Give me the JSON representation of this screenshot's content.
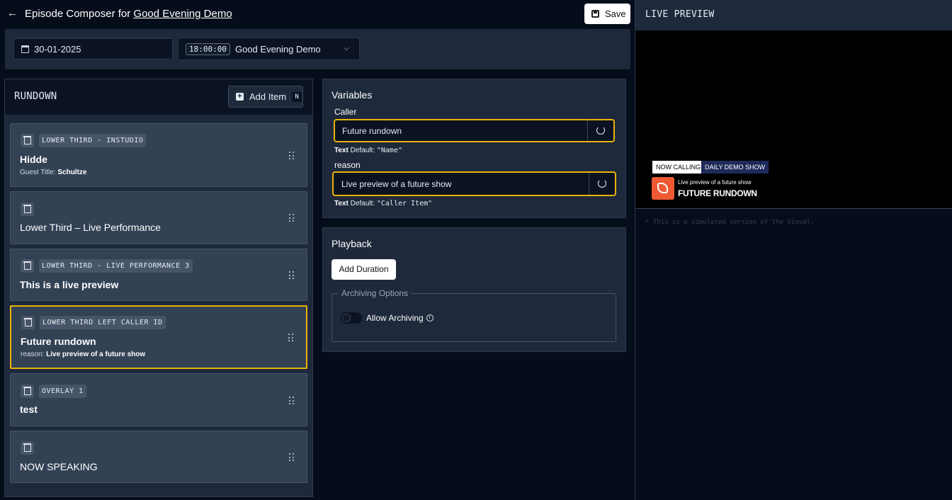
{
  "header": {
    "title_prefix": "Episode Composer for",
    "show_link": "Good Evening Demo",
    "save_label": "Save"
  },
  "datebar": {
    "date": "30-01-2025",
    "time": "18:00:00",
    "show_name": "Good Evening Demo"
  },
  "rundown": {
    "title": "RUNDOWN",
    "add_item_label": "Add Item",
    "add_item_shortcut": "N",
    "items": [
      {
        "tag": "LOWER THIRD - INSTUDIO",
        "title": "Hidde",
        "sub_label": "Guest Title:",
        "sub_value": "Schultze"
      },
      {
        "title": "Lower Third – Live Performance"
      },
      {
        "tag": "LOWER THIRD - LIVE PERFORMANCE 3",
        "title": "This is a live preview"
      },
      {
        "tag": "LOWER THIRD LEFT CALLER ID",
        "title": "Future rundown",
        "sub_label": "reason:",
        "sub_value": "Live preview of a future show"
      },
      {
        "tag": "OVERLAY 1",
        "title": "test"
      },
      {
        "title": "NOW SPEAKING"
      }
    ]
  },
  "variables": {
    "title": "Variables",
    "fields": [
      {
        "label": "Caller",
        "value": "Future rundown",
        "type": "Text",
        "default_label": "Default:",
        "default_value": "\"Name\""
      },
      {
        "label": "reason",
        "value": "Live preview of a future show",
        "type": "Text",
        "default_label": "Default:",
        "default_value": "\"Caller Item\""
      }
    ]
  },
  "playback": {
    "title": "Playback",
    "add_duration_label": "Add Duration",
    "archiving_legend": "Archiving Options",
    "allow_archiving_label": "Allow Archiving",
    "allow_archiving": false
  },
  "preview": {
    "title": "LIVE PREVIEW",
    "badge_now": "NOW CALLING",
    "badge_show": "DAILY DEMO SHOW",
    "reason": "Live preview of a future show",
    "name": "FUTURE RUNDOWN",
    "note": "* This is a simulated version of the Visual."
  },
  "colors": {
    "accent_selected": "#eab308",
    "lower_third_icon": "#ef5a33",
    "show_badge_bg": "#1e2a5a"
  },
  "icons": [
    "back-arrow-icon",
    "save-icon",
    "calendar-icon",
    "chevron-down-icon",
    "plus-icon",
    "trash-icon",
    "drag-handle-icon",
    "reset-icon",
    "info-icon",
    "phone-icon"
  ]
}
